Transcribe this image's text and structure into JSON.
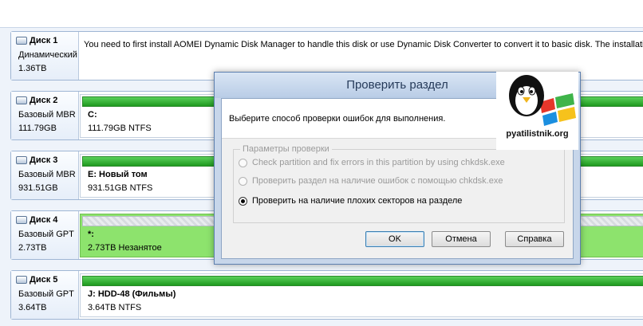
{
  "disks": [
    {
      "name": "Диск 1",
      "type": "Динамический",
      "size": "1.36TB",
      "message": "You need to first install AOMEI Dynamic Disk Manager to handle this disk or use Dynamic Disk Converter to convert it to basic disk. The installation fi"
    },
    {
      "name": "Диск 2",
      "type": "Базовый MBR",
      "size": "111.79GB",
      "partition": {
        "name": "C:",
        "detail": "111.79GB NTFS"
      }
    },
    {
      "name": "Диск 3",
      "type": "Базовый MBR",
      "size": "931.51GB",
      "partition": {
        "name": "E: Новый том",
        "detail": "931.51GB NTFS"
      }
    },
    {
      "name": "Диск 4",
      "type": "Базовый GPT",
      "size": "2.73TB",
      "partition": {
        "name": "*:",
        "detail": "2.73TB Незанятое"
      }
    },
    {
      "name": "Диск 5",
      "type": "Базовый GPT",
      "size": "3.64TB",
      "partition": {
        "name": "J: HDD-48 (Фильмы)",
        "detail": "3.64TB NTFS"
      }
    }
  ],
  "dialog": {
    "title": "Проверить раздел",
    "prompt": "Выберите способ проверки ошибок для выполнения.",
    "group_label": "Параметры проверки",
    "options": [
      {
        "label": "Check partition and fix errors in this partition by using chkdsk.exe",
        "enabled": false,
        "checked": false
      },
      {
        "label": "Проверить раздел на наличие ошибок с помощью chkdsk.exe",
        "enabled": false,
        "checked": false
      },
      {
        "label": "Проверить на наличие плохих секторов на разделе",
        "enabled": true,
        "checked": true
      }
    ],
    "buttons": {
      "ok": "OK",
      "cancel": "Отмена",
      "help": "Справка"
    }
  },
  "watermark": {
    "text": "pyatilistnik.org"
  },
  "colors": {
    "partition_bar": "#2fb52f",
    "unallocated": "#8de36d",
    "dialog_frame": "#c7d6ea"
  }
}
